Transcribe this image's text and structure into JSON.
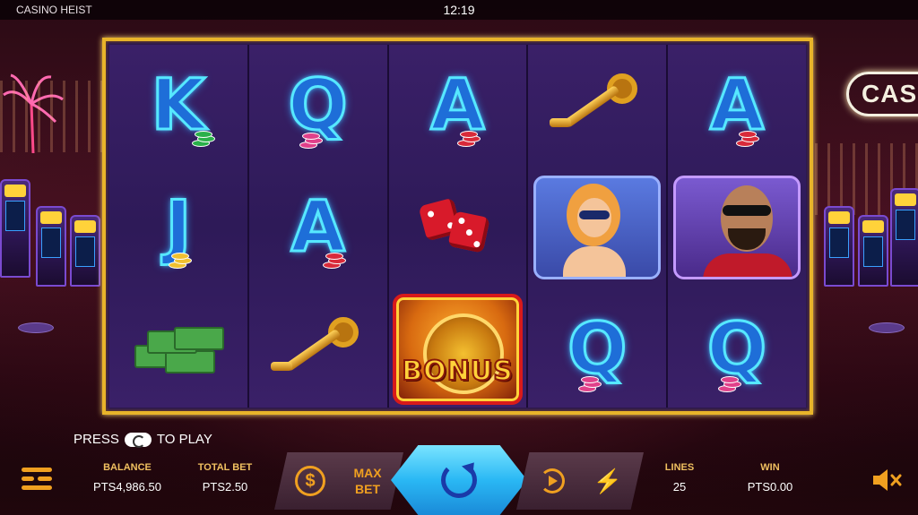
{
  "app": {
    "title": "CASINO HEIST",
    "clock": "12:19"
  },
  "background": {
    "neon_sign": "CAS"
  },
  "reels": [
    [
      "K",
      "J",
      "cash"
    ],
    [
      "Q",
      "A",
      "key"
    ],
    [
      "A",
      "dice",
      "bonus"
    ],
    [
      "key",
      "woman",
      "Q"
    ],
    [
      "A",
      "man",
      "Q"
    ]
  ],
  "symbols": {
    "bonus_label": "BONUS"
  },
  "prompt": {
    "press": "PRESS",
    "to_play": "TO PLAY"
  },
  "stats": {
    "balance_label": "BALANCE",
    "balance_value": "PTS4,986.50",
    "totalbet_label": "TOTAL BET",
    "totalbet_value": "PTS2.50",
    "lines_label": "LINES",
    "lines_value": "25",
    "win_label": "WIN",
    "win_value": "PTS0.00"
  },
  "buttons": {
    "coin_symbol": "$",
    "max_bet_line1": "MAX",
    "max_bet_line2": "BET",
    "turbo_symbol": "⚡"
  },
  "colors": {
    "frame": "#e8b42a",
    "accent": "#f0a020",
    "spin": "#2ab8f4",
    "letter": "#56e8ff"
  }
}
